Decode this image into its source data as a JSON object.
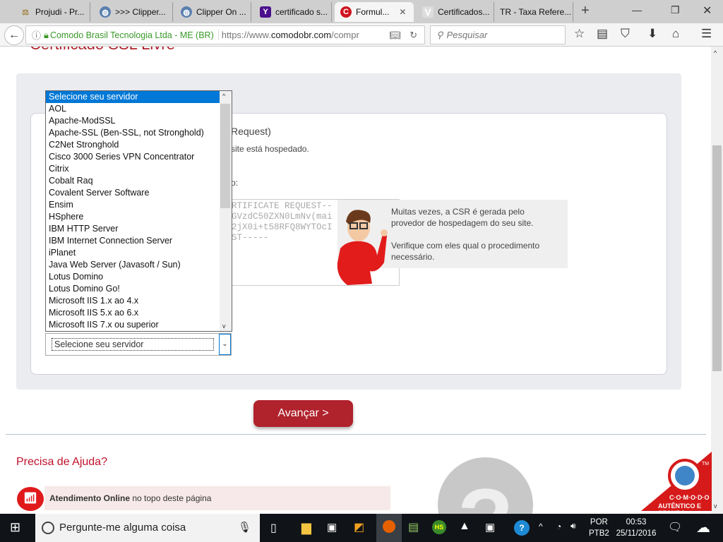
{
  "browser": {
    "tabs": [
      {
        "label": "Projudi - Pr...",
        "icon": "scales-icon"
      },
      {
        "label": ">>> Clipper...",
        "icon": "globe-icon"
      },
      {
        "label": "Clipper On ...",
        "icon": "globe-icon"
      },
      {
        "label": "certificado s...",
        "icon": "yahoo-icon"
      },
      {
        "label": "Formul...",
        "icon": "comodo-icon",
        "active": true
      },
      {
        "label": "Certificados...",
        "icon": "v-icon"
      },
      {
        "label": "TR - Taxa Refere...",
        "icon": "none"
      }
    ],
    "identity": "Comodo Brasil Tecnologia Ltda - ME (BR)",
    "url_prefix": "https://www.",
    "url_domain": "comodobr.com",
    "url_suffix": "/compr",
    "search_placeholder": "Pesquisar"
  },
  "page": {
    "title": "Certificado SSL Livre",
    "section_title": "Request)",
    "hosted_text": "site está hospedado.",
    "colon_text": "o:",
    "csr_lines": [
      "RTIFICATE REQUEST--",
      "GVzdC50ZXN0LmNv(mai",
      "2jX0i+t58RFQ8WYTOcI",
      "ST-----"
    ],
    "tip_line1": "Muitas vezes, a CSR é gerada pelo",
    "tip_line2": "provedor de hospedagem do seu site.",
    "tip_line3": "Verifique com eles qual o procedimento",
    "tip_line4": "necessário.",
    "server_options": [
      "Selecione seu servidor",
      "AOL",
      "Apache-ModSSL",
      "Apache-SSL (Ben-SSL, not Stronghold)",
      "C2Net Stronghold",
      "Cisco 3000 Series VPN Concentrator",
      "Citrix",
      "Cobalt Raq",
      "Covalent Server Software",
      "Ensim",
      "HSphere",
      "IBM HTTP Server",
      "IBM Internet Connection Server",
      "iPlanet",
      "Java Web Server (Javasoft / Sun)",
      "Lotus Domino",
      "Lotus Domino Go!",
      "Microsoft IIS 1.x ao 4.x",
      "Microsoft IIS 5.x ao 6.x",
      "Microsoft IIS 7.x ou superior"
    ],
    "selected_server": "Selecione seu servidor",
    "next_button": "Avançar >",
    "help_title": "Precisa de Ajuda?",
    "online_bold": "Atendimento Online",
    "online_rest": " no topo deste página",
    "logo_text": "C·O·M·O·D·O",
    "logo_sub": "AUTÊNTICO E SEGURO",
    "logo_tm": "TM",
    "accent": "#b0222c"
  },
  "taskbar": {
    "search_placeholder": "Pergunte-me alguma coisa",
    "lang1": "POR",
    "lang2": "PTB2",
    "time": "00:53",
    "date": "25/11/2016"
  }
}
